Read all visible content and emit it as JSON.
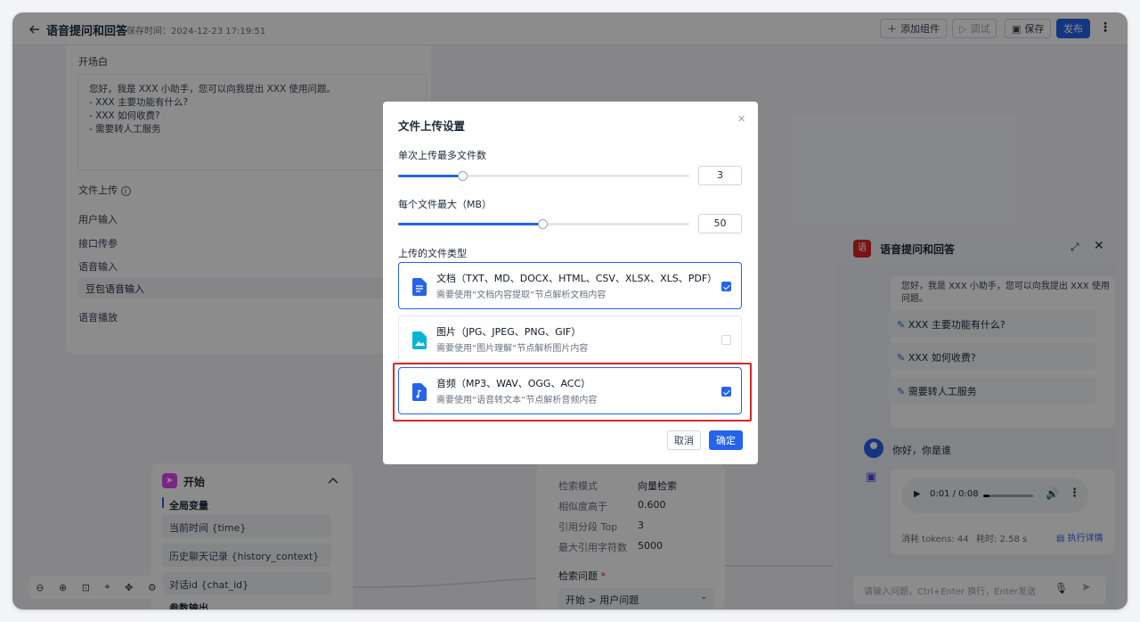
{
  "header": {
    "back_icon": "arrow-left-icon",
    "title": "语音提问和回答",
    "saved_time": "保存时间：2024-12-23 17:19:51",
    "add_component": "添加组件",
    "debug": "调试",
    "save": "保存",
    "publish": "发布"
  },
  "settings_panel": {
    "opening_label": "开场白",
    "opening_text": "您好，我是 XXX 小助手，您可以向我提出 XXX 使用问题。\n- XXX 主要功能有什么?\n- XXX 如何收费?\n- 需要转人工服务",
    "file_upload": "文件上传",
    "user_input": "用户输入",
    "api_params": "接口传参",
    "voice_input": "语音输入",
    "voice_input_value": "豆包语音输入",
    "voice_playback": "语音播放"
  },
  "start_node": {
    "title": "开始",
    "global_vars": "全局变量",
    "vars": [
      "当前时间 {time}",
      "历史聊天记录 {history_context}",
      "对话id {chat_id}"
    ],
    "param_output": "参数输出"
  },
  "retrieval_node": {
    "rows": [
      {
        "label": "检索模式",
        "value": "向量检索"
      },
      {
        "label": "相似度高于",
        "value": "0.600"
      },
      {
        "label": "引用分段 Top",
        "value": "3"
      },
      {
        "label": "最大引用字符数",
        "value": "5000"
      }
    ],
    "question_label": "检索问题",
    "question_value": "开始 > 用户问题"
  },
  "chat": {
    "avatar_text": "语",
    "title": "语音提问和回答",
    "greeting_partial": "您好，我是 XXX 小助手，您可以向我提出 XXX 使用",
    "greeting_end": "问题。",
    "suggestions": [
      "XXX 主要功能有什么?",
      "XXX 如何收费?",
      "需要转人工服务"
    ],
    "user_message": "你好，你是谁",
    "audio_time": "0:01 / 0:08",
    "tokens": "消耗 tokens: 44",
    "elapsed": "耗时: 2.58 s",
    "details": "执行详情",
    "input_placeholder": "请输入问题，Ctrl+Enter 换行，Enter发送"
  },
  "modal": {
    "title": "文件上传设置",
    "max_files_label": "单次上传最多文件数",
    "max_files_value": "3",
    "max_files_fraction": 0.2,
    "max_size_label": "每个文件最大（MB）",
    "max_size_value": "50",
    "max_size_fraction": 0.5,
    "types_label": "上传的文件类型",
    "options": [
      {
        "title": "文档（TXT、MD、DOCX、HTML、CSV、XLSX、XLS、PDF）",
        "desc": "需要使用“文档内容提取”节点解析文档内容",
        "checked": true,
        "icon": "document-icon"
      },
      {
        "title": "图片（JPG、JPEG、PNG、GIF）",
        "desc": "需要使用“图片理解”节点解析图片内容",
        "checked": false,
        "icon": "image-icon"
      },
      {
        "title": "音频（MP3、WAV、OGG、ACC）",
        "desc": "需要使用“语音转文本”节点解析音频内容",
        "checked": true,
        "icon": "audio-file-icon"
      }
    ],
    "cancel": "取消",
    "confirm": "确定"
  },
  "colors": {
    "primary": "#2563eb",
    "highlight": "#dc2626",
    "start_icon": "#d946ef",
    "chat_avatar": "#dc2626"
  }
}
